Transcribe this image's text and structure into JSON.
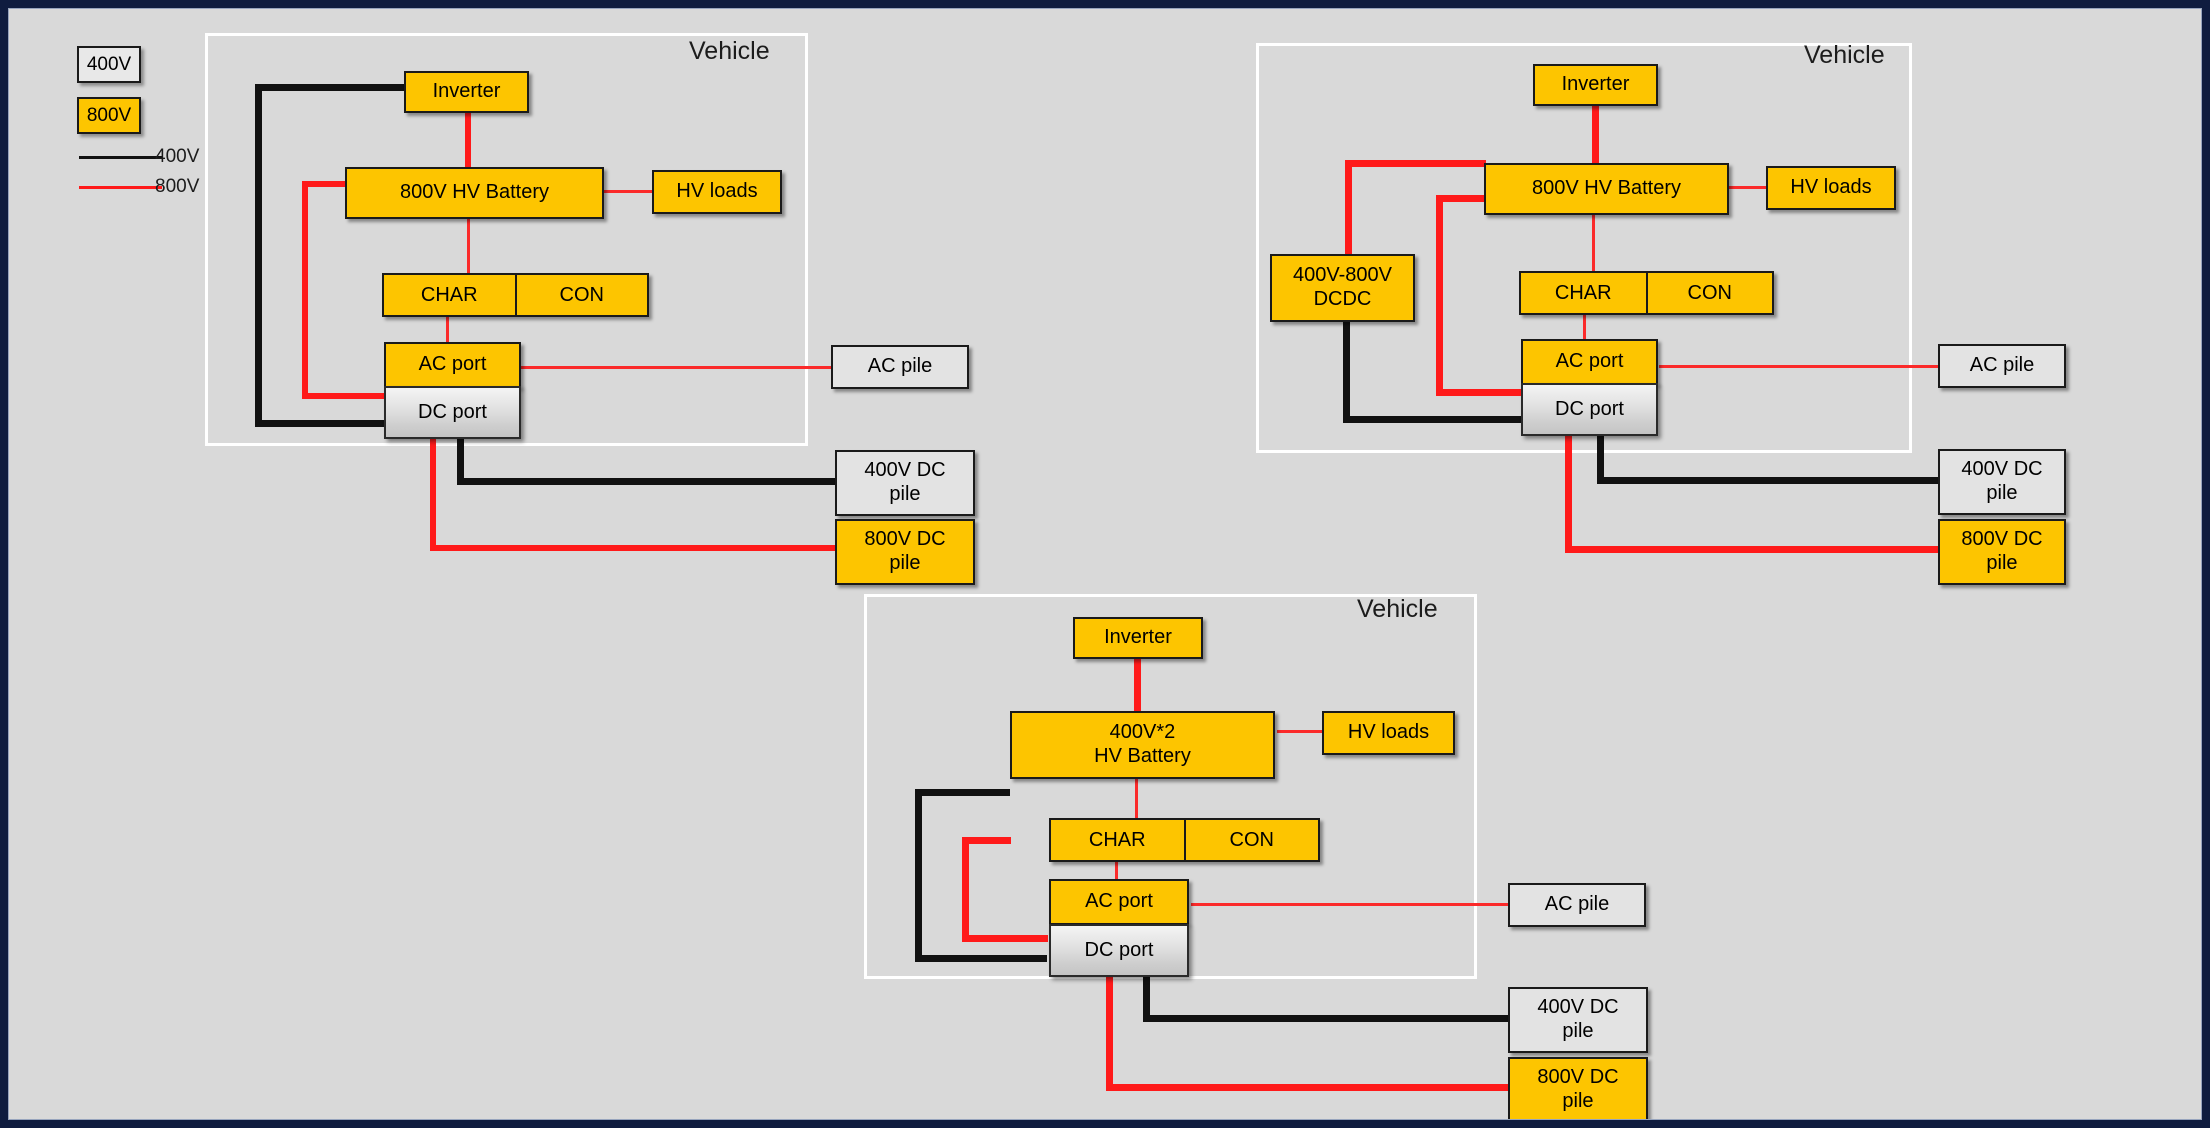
{
  "colors": {
    "background": "#d9d9d9",
    "outer_border": "#0f1c3f",
    "yellow_800v": "#fdc500",
    "gray_400v": "#e3e3e3",
    "wire_400v": "#111111",
    "wire_800v": "#ff1a1a",
    "vehicle_frame": "#ffffff"
  },
  "legend": {
    "chip_400v": "400V",
    "chip_800v": "800V",
    "line_400v_label": "400V",
    "line_800v_label": "800V"
  },
  "diagrams": [
    {
      "id": "diagram-1",
      "vehicle_label": "Vehicle",
      "nodes": {
        "inverter": "Inverter",
        "battery": "800V HV Battery",
        "hv_loads": "HV loads",
        "char": "CHAR",
        "con": "CON",
        "ac_port": "AC port",
        "dc_port": "DC port",
        "ac_pile": "AC pile",
        "dc_pile_400": "400V DC\npile",
        "dc_pile_800": "800V DC\npile"
      }
    },
    {
      "id": "diagram-2",
      "vehicle_label": "Vehicle",
      "nodes": {
        "inverter": "Inverter",
        "battery": "800V HV Battery",
        "hv_loads": "HV loads",
        "dcdc": "400V-800V\nDCDC",
        "char": "CHAR",
        "con": "CON",
        "ac_port": "AC port",
        "dc_port": "DC port",
        "ac_pile": "AC pile",
        "dc_pile_400": "400V DC\npile",
        "dc_pile_800": "800V DC\npile"
      }
    },
    {
      "id": "diagram-3",
      "vehicle_label": "Vehicle",
      "nodes": {
        "inverter": "Inverter",
        "battery": "400V*2\nHV Battery",
        "hv_loads": "HV loads",
        "char": "CHAR",
        "con": "CON",
        "ac_port": "AC port",
        "dc_port": "DC port",
        "ac_pile": "AC pile",
        "dc_pile_400": "400V DC\npile",
        "dc_pile_800": "800V DC\npile"
      }
    }
  ]
}
